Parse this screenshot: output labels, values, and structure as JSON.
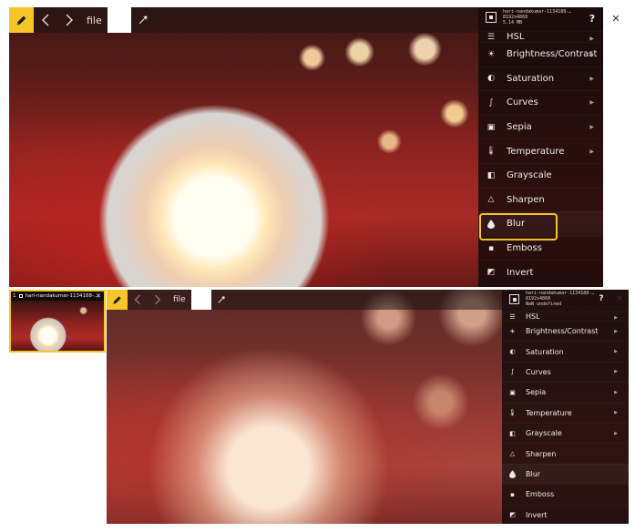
{
  "toolbar": {
    "file_label": "file"
  },
  "image_info": {
    "top": {
      "line1": "hari-nandakumar-1134188-…",
      "line2": "8192x4868",
      "line3": "5.14 MB"
    },
    "bottom": {
      "line1": "hari-nandakumar-1134188-…",
      "line2": "8192x4868",
      "line3": "NaN undefined"
    }
  },
  "help_label": "?",
  "close_label": "✕",
  "menu": {
    "items": [
      {
        "label": "HSL",
        "icon": "sliders-icon",
        "glyph": "☰"
      },
      {
        "label": "Brightness/Contrast",
        "icon": "sun-icon",
        "glyph": "☀"
      },
      {
        "label": "Saturation",
        "icon": "half-circle-icon",
        "glyph": "◐"
      },
      {
        "label": "Curves",
        "icon": "curve-icon",
        "glyph": "∫"
      },
      {
        "label": "Sepia",
        "icon": "sepia-icon",
        "glyph": "▣"
      },
      {
        "label": "Temperature",
        "icon": "thermometer-icon",
        "glyph": "🌡"
      },
      {
        "label": "Grayscale",
        "icon": "grayscale-icon",
        "glyph": "◧"
      },
      {
        "label": "Sharpen",
        "icon": "triangle-icon",
        "glyph": "△"
      },
      {
        "label": "Blur",
        "icon": "drop-icon",
        "glyph": "💧"
      },
      {
        "label": "Emboss",
        "icon": "emboss-icon",
        "glyph": "▪"
      },
      {
        "label": "Invert",
        "icon": "invert-icon",
        "glyph": "◩"
      }
    ],
    "submenu_arrow": "▶"
  },
  "thumbnail": {
    "index": "1",
    "title": "hari-nandakumar-1134188-…",
    "close_label": "✕"
  },
  "colors": {
    "accent": "#f5c52a",
    "menu_bg": "#120a0a"
  }
}
